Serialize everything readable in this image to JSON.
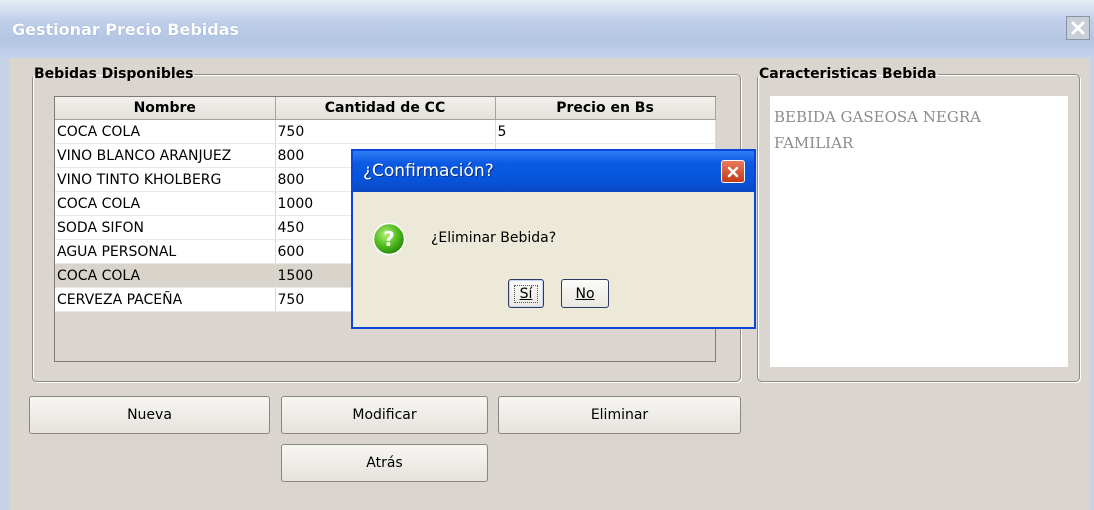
{
  "window": {
    "title": "Gestionar Precio Bebidas"
  },
  "group_bebidas": {
    "legend": "Bebidas Disponibles",
    "columns": [
      "Nombre",
      "Cantidad de CC",
      "Precio en Bs"
    ],
    "rows": [
      {
        "nombre": "COCA COLA",
        "cc": "750",
        "precio": "5"
      },
      {
        "nombre": "VINO BLANCO ARANJUEZ",
        "cc": "800",
        "precio": ""
      },
      {
        "nombre": "VINO TINTO KHOLBERG",
        "cc": "800",
        "precio": ""
      },
      {
        "nombre": "COCA COLA",
        "cc": "1000",
        "precio": ""
      },
      {
        "nombre": "SODA SIFON",
        "cc": "450",
        "precio": ""
      },
      {
        "nombre": "AGUA PERSONAL",
        "cc": "600",
        "precio": ""
      },
      {
        "nombre": "COCA COLA",
        "cc": "1500",
        "precio": ""
      },
      {
        "nombre": "CERVEZA PACEÑA",
        "cc": "750",
        "precio": ""
      }
    ],
    "selected_row_index": 6
  },
  "group_caracteristicas": {
    "legend": "Caracteristicas Bebida",
    "text": "BEBIDA GASEOSA NEGRA\nFAMILIAR"
  },
  "buttons": {
    "nueva": "Nueva",
    "modificar": "Modificar",
    "eliminar": "Eliminar",
    "atras": "Atrás"
  },
  "dialog": {
    "title": "¿Confirmación?",
    "message": "¿Eliminar Bebida?",
    "icon": "question-icon",
    "yes_label": "Sí",
    "no_label": "No"
  },
  "colors": {
    "dialog_title": "#0754db",
    "window_bg": "#dad6cf",
    "selected_row": "#d8d4cc",
    "close_red": "#c33a1a"
  }
}
